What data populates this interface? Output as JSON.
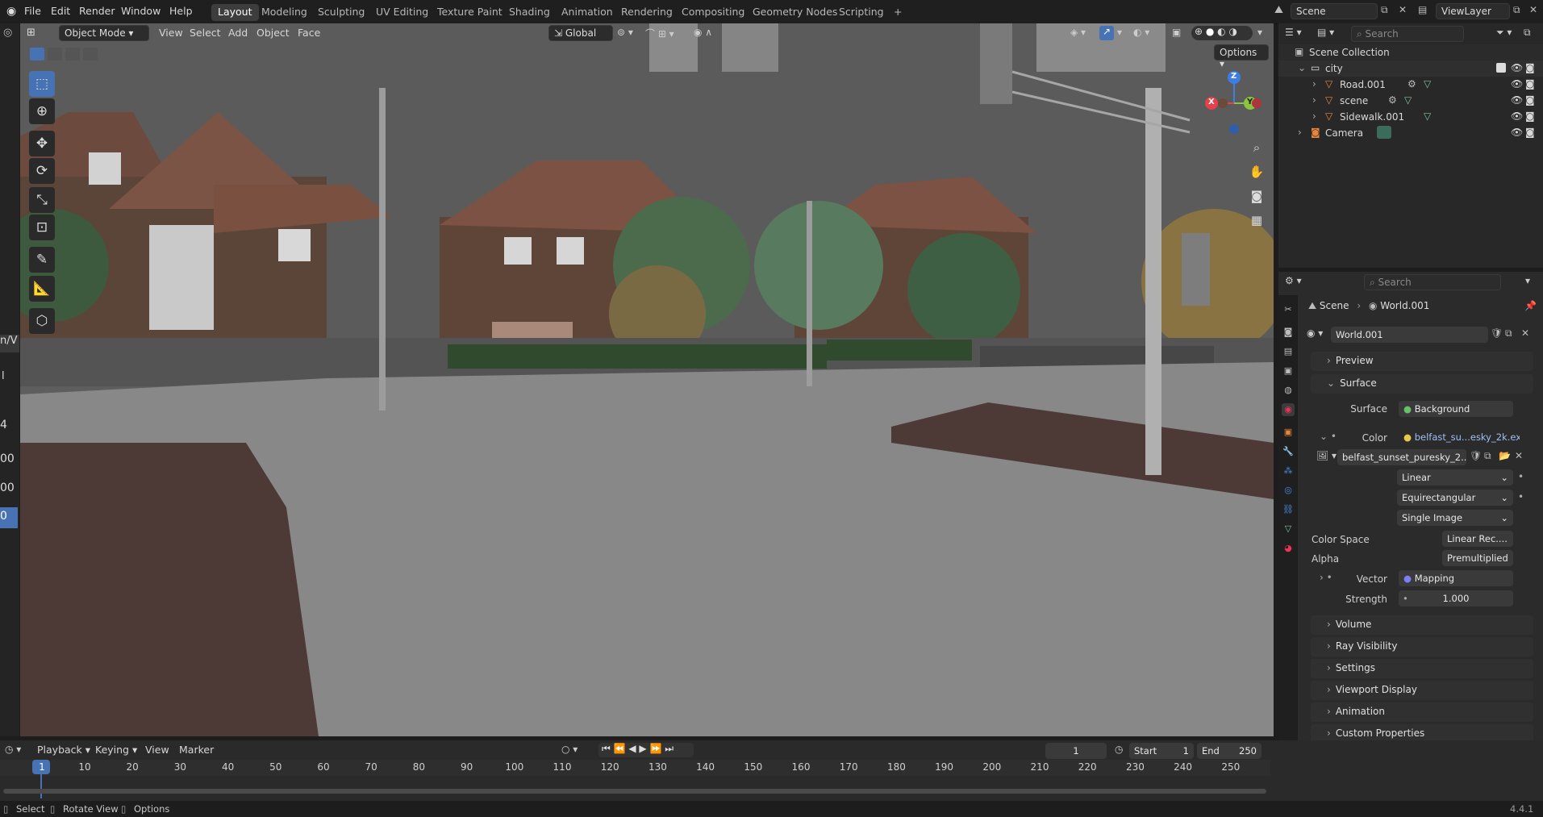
{
  "menubar": {
    "items": [
      "File",
      "Edit",
      "Render",
      "Window",
      "Help"
    ],
    "workspaces": [
      "Layout",
      "Modeling",
      "Sculpting",
      "UV Editing",
      "Texture Paint",
      "Shading",
      "Animation",
      "Rendering",
      "Compositing",
      "Geometry Nodes",
      "Scripting"
    ],
    "active_workspace": "Layout",
    "add_tab": "+",
    "scene_name": "Scene",
    "view_layer": "ViewLayer"
  },
  "viewport_header": {
    "mode": "Object Mode",
    "menus": [
      "View",
      "Select",
      "Add",
      "Object",
      "Face"
    ],
    "transform_orientation": "Global",
    "options_label": "Options"
  },
  "outliner": {
    "search_placeholder": "Search",
    "root": "Scene Collection",
    "collection": "city",
    "objects": [
      "Road.001",
      "scene",
      "Sidewalk.001"
    ],
    "camera": "Camera"
  },
  "properties": {
    "search_placeholder": "Search",
    "breadcrumb_scene": "Scene",
    "breadcrumb_world": "World.001",
    "world_name": "World.001",
    "panels": {
      "preview": "Preview",
      "surface": "Surface",
      "volume": "Volume",
      "ray_visibility": "Ray Visibility",
      "settings": "Settings",
      "viewport_display": "Viewport Display",
      "animation": "Animation",
      "custom_properties": "Custom Properties"
    },
    "surface_label": "Surface",
    "surface_value": "Background",
    "color_label": "Color",
    "color_value": "belfast_su...esky_2k.exr",
    "image_name": "belfast_sunset_puresky_2...",
    "interpolation": "Linear",
    "projection": "Equirectangular",
    "source": "Single Image",
    "color_space_label": "Color Space",
    "color_space_value": "Linear Rec....",
    "alpha_label": "Alpha",
    "alpha_value": "Premultiplied",
    "vector_label": "Vector",
    "vector_value": "Mapping",
    "strength_label": "Strength",
    "strength_value": "1.000"
  },
  "timeline": {
    "menus": [
      "Playback",
      "Keying",
      "View",
      "Marker"
    ],
    "current_frame": "1",
    "start_label": "Start",
    "start_value": "1",
    "end_label": "End",
    "end_value": "250",
    "ticks": [
      "1",
      "10",
      "20",
      "30",
      "40",
      "50",
      "60",
      "70",
      "80",
      "90",
      "100",
      "110",
      "120",
      "130",
      "140",
      "150",
      "160",
      "170",
      "180",
      "190",
      "200",
      "210",
      "220",
      "230",
      "240",
      "250"
    ]
  },
  "statusbar": {
    "select": "Select",
    "rotate_view": "Rotate View",
    "options": "Options",
    "version": "4.4.1"
  },
  "left_edge_fragments": [
    "n/V",
    "l",
    "4",
    "00",
    "00",
    "0"
  ],
  "gizmo_axes": [
    "Z",
    "X",
    "Y"
  ],
  "colors": {
    "accent": "#4772b3",
    "x_axis": "#e5414a",
    "y_axis": "#8bc43f",
    "z_axis": "#3d7ee6"
  }
}
